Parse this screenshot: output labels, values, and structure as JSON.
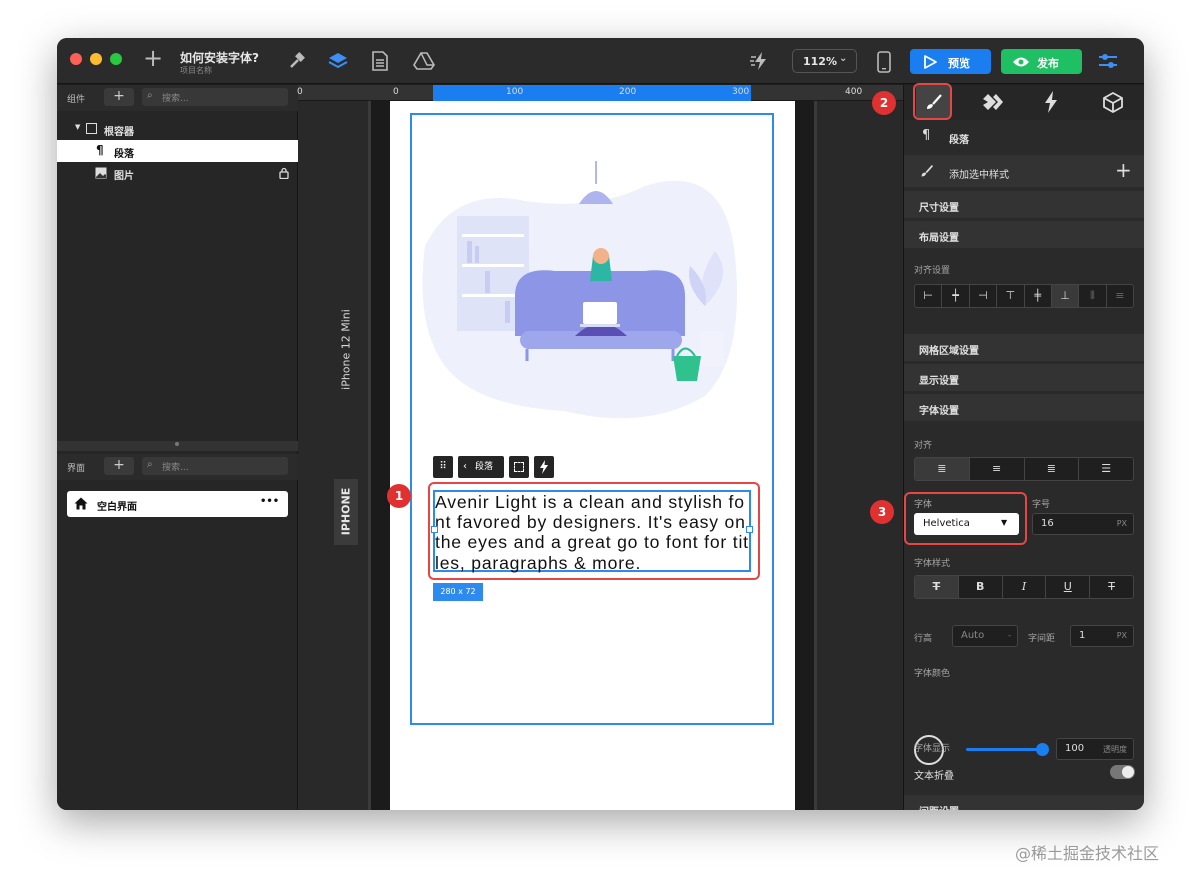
{
  "titlebar": {
    "doc_title": "如何安装字体?",
    "doc_subtitle": "项目名称",
    "zoom": "112%",
    "preview_label": "预览",
    "publish_label": "发布"
  },
  "components_panel": {
    "label": "组件",
    "search_placeholder": "搜索...",
    "tree": [
      {
        "label": "根容器"
      },
      {
        "label": "段落"
      },
      {
        "label": "图片"
      }
    ]
  },
  "screens_panel": {
    "label": "界面",
    "search_placeholder": "搜索...",
    "screen_name": "空白界面",
    "more": "•••"
  },
  "ruler": {
    "t0a": "0",
    "t0b": "0",
    "t100": "100",
    "t200": "200",
    "t300": "300",
    "t400": "400"
  },
  "canvas": {
    "device_name": "iPhone 12 Mini",
    "device_tab": "IPHONE",
    "toolbar_label": "段落",
    "paragraph_text": "Avenir Light is a clean and stylish font favored by designers. It's easy on the eyes and a great go to font for titles, paragraphs & more.",
    "size_tag": "280 x 72"
  },
  "right_panel": {
    "element_type": "段落",
    "add_style": "添加选中样式",
    "sections": {
      "size": "尺寸设置",
      "layout": "布局设置",
      "align_settings": "对齐设置",
      "grid": "网格区域设置",
      "display": "显示设置",
      "font_settings": "字体设置",
      "spacing": "间距设置"
    },
    "labels": {
      "align": "对齐",
      "font": "字体",
      "font_size": "字号",
      "font_style": "字体样式",
      "line_height": "行高",
      "letter_spacing": "字间距",
      "font_color": "字体颜色",
      "font_display": "字体显示",
      "text_wrap": "文本折叠"
    },
    "values": {
      "font": "Helvetica",
      "font_size": "16",
      "font_size_unit": "PX",
      "line_height": "Auto",
      "line_height_suffix": "-",
      "letter_spacing": "1",
      "letter_spacing_unit": "PX",
      "opacity": "100",
      "opacity_label": "透明度"
    },
    "opacity_level": 1.0
  },
  "annotations": {
    "badge1": "1",
    "badge2": "2",
    "badge3": "3"
  },
  "watermark": "@稀土掘金技术社区",
  "colors": {
    "accent": "#1a7df0",
    "publish": "#1fbf63",
    "annotation": "#e84545"
  }
}
